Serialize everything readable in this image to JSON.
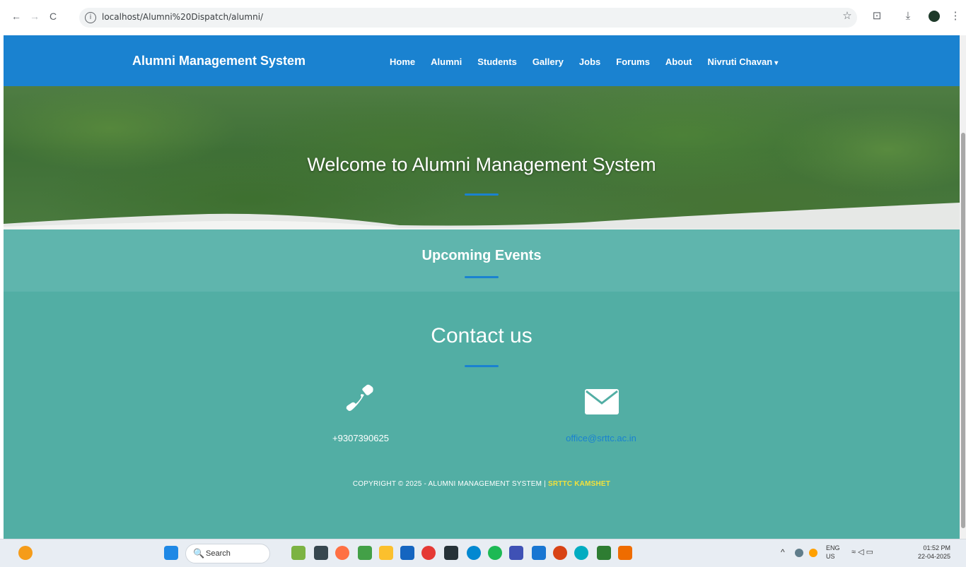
{
  "browser": {
    "url": "localhost/Alumni%20Dispatch/alumni/",
    "back": "←",
    "forward": "→",
    "reload": "C",
    "info": "i",
    "star": "☆",
    "extensions": "⊡",
    "download": "⤓",
    "menu": "⋮"
  },
  "navbar": {
    "brand": "Alumni Management System",
    "links": [
      "Home",
      "Alumni",
      "Students",
      "Gallery",
      "Jobs",
      "Forums",
      "About"
    ],
    "user": "Nivruti Chavan",
    "caret": "▾",
    "color": "#1a82d0"
  },
  "hero": {
    "title": "Welcome to Alumni Management System"
  },
  "events": {
    "title": "Upcoming Events"
  },
  "contact": {
    "title": "Contact us",
    "phone": "+9307390625",
    "email": "office@srttc.ac.in",
    "copyright_prefix": "COPYRIGHT © 2025 - ALUMNI MANAGEMENT SYSTEM | ",
    "copyright_org": "SRTTC KAMSHET"
  },
  "taskbar": {
    "search_label": "Search",
    "search_icon": "🔍",
    "lang_top": "ENG",
    "lang_bottom": "US",
    "time": "01:52 PM",
    "date": "22-04-2025"
  }
}
